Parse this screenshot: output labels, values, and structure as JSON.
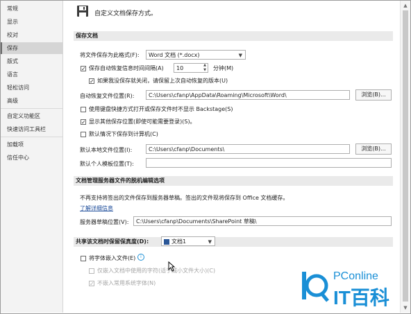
{
  "sidebar": {
    "items": [
      "常规",
      "显示",
      "校对",
      "保存",
      "版式",
      "语言",
      "轻松访问",
      "高级",
      "自定义功能区",
      "快速访问工具栏",
      "加载项",
      "信任中心"
    ]
  },
  "header": {
    "title": "自定义文档保存方式。"
  },
  "save_docs": {
    "section_title": "保存文档",
    "format_label": "将文件保存为此格式(F):",
    "format_value": "Word 文档 (*.docx)",
    "autorecover_label": "保存自动恢复信息时间间隔(A)",
    "autorecover_value": "10",
    "minutes_label": "分钟(M)",
    "keep_last_label": "如果我没保存就关闭，请保留上次自动恢复的版本(U)",
    "autorecover_location_label": "自动恢复文件位置(R):",
    "autorecover_location_value": "C:\\Users\\cfanp\\AppData\\Roaming\\Microsoft\\Word\\",
    "browse_label": "浏览(B)...",
    "no_backstage_label": "使用键盘快捷方式打开或保存文件时不显示 Backstage(S)",
    "show_other_locations_label": "显示其他保存位置(即使可能需要登录)(S)。",
    "save_to_computer_label": "默认情况下保存到计算机(C)",
    "default_local_label": "默认本地文件位置(I):",
    "default_local_value": "C:\\Users\\cfanp\\Documents\\",
    "browse2_label": "浏览(B)...",
    "default_template_label": "默认个人模板位置(T):",
    "default_template_value": ""
  },
  "offline": {
    "section_title": "文档管理服务器文件的脱机编辑选项",
    "notice": "不再支持将签出的文件保存到服务器草稿。签出的文件现将保存到 Office 文档缓存。",
    "learn_more": "了解详细信息",
    "drafts_label": "服务器草稿位置(V):",
    "drafts_value": "C:\\Users\\cfanp\\Documents\\SharePoint 草稿\\"
  },
  "fidelity": {
    "section_title": "共享该文档时保留保真度(D):",
    "doc_value": "文档1",
    "embed_fonts_label": "将字体嵌入文件(E)",
    "info_icon": "info-icon",
    "embed_used_label": "仅嵌入文档中使用的字符(适于减小文件大小)(C)",
    "no_common_label": "不嵌入常用系统字体(N)"
  },
  "watermark": {
    "brand": "PConline",
    "brand2": "IT百科"
  },
  "colors": {
    "accent": "#1a8fd6",
    "section_bg": "#eaeaea",
    "sidebar_bg": "#f3f3f3"
  }
}
